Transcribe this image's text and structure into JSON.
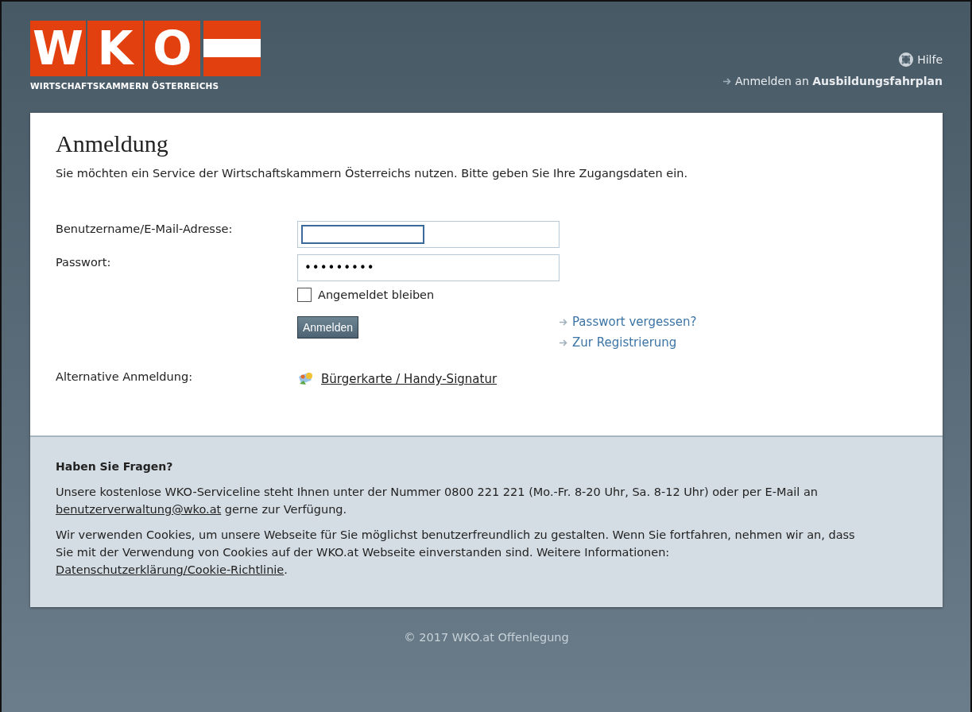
{
  "logo": {
    "letters": [
      "W",
      "K",
      "O"
    ],
    "subtitle": "WIRTSCHAFTSKAMMERN ÖSTERREICHS"
  },
  "header": {
    "help": "Hilfe",
    "login_target_prefix": "Anmelden an",
    "login_target": "Ausbildungsfahrplan"
  },
  "login": {
    "title": "Anmeldung",
    "intro": "Sie möchten ein Service der Wirtschaftskammern Österreichs nutzen. Bitte geben Sie Ihre Zugangsdaten ein.",
    "username_label": "Benutzername/E-Mail-Adresse:",
    "password_label": "Passwort:",
    "password_value": "•••••••••",
    "remember": {
      "label": "Angemeldet bleiben",
      "checked": false
    },
    "submit": "Anmelden",
    "links": [
      "Passwort vergessen?",
      "Zur Registrierung"
    ],
    "alternative_label": "Alternative Anmeldung:",
    "alternative_link": "Bürgerkarte / Handy-Signatur"
  },
  "info": {
    "title": "Haben Sie Fragen?",
    "paragraphs": [
      [
        {
          "kind": "text",
          "text": "Unsere kostenlose WKO-Serviceline steht Ihnen unter der Nummer 0800 221 221 (Mo.-Fr. 8-20 Uhr, Sa. 8-12 Uhr) oder per E-Mail an "
        },
        {
          "kind": "link",
          "text": "benutzerverwaltung@wko.at"
        },
        {
          "kind": "text",
          "text": " gerne zur Verfügung."
        }
      ],
      [
        {
          "kind": "text",
          "text": "Wir verwenden Cookies, um unsere Webseite für Sie möglichst benutzerfreundlich zu gestalten. Wenn Sie fortfahren, nehmen wir an, dass Sie mit der Verwendung von Cookies auf der WKO.at Webseite einverstanden sind. Weitere Informationen: "
        },
        {
          "kind": "link",
          "text": "Datenschutzerklärung/Cookie-Richtlinie"
        },
        {
          "kind": "text",
          "text": "."
        }
      ]
    ]
  },
  "footer": {
    "copyright": "© 2017 WKO.at",
    "link": "Offenlegung"
  }
}
